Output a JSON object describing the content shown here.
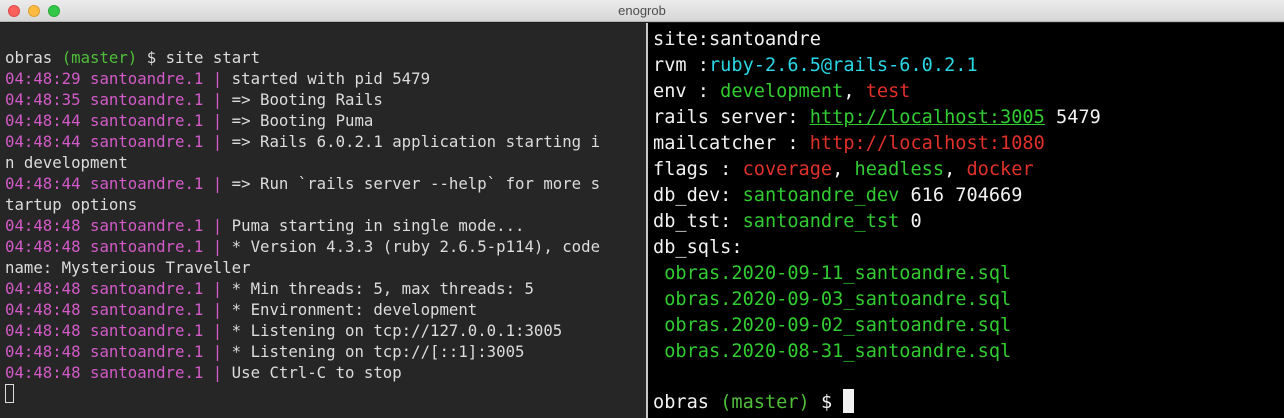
{
  "window": {
    "title": "enogrob"
  },
  "left": {
    "prompt": {
      "dir": "obras",
      "branch": "(master)",
      "symbol": "$",
      "command": "site start"
    },
    "logs": [
      {
        "ts": "04:48:29 santoandre.1 |",
        "msg": " started with pid 5479"
      },
      {
        "ts": "04:48:35 santoandre.1 |",
        "msg": " => Booting Rails"
      },
      {
        "ts": "04:48:44 santoandre.1 |",
        "msg": " => Booting Puma"
      },
      {
        "ts": "04:48:44 santoandre.1 |",
        "msg": " => Rails 6.0.2.1 application starting i"
      },
      {
        "ts": "",
        "msg": "n development"
      },
      {
        "ts": "04:48:44 santoandre.1 |",
        "msg": " => Run `rails server --help` for more s"
      },
      {
        "ts": "",
        "msg": "tartup options"
      },
      {
        "ts": "04:48:48 santoandre.1 |",
        "msg": " Puma starting in single mode..."
      },
      {
        "ts": "04:48:48 santoandre.1 |",
        "msg": " * Version 4.3.3 (ruby 2.6.5-p114), code"
      },
      {
        "ts": "",
        "msg": "name: Mysterious Traveller"
      },
      {
        "ts": "04:48:48 santoandre.1 |",
        "msg": " * Min threads: 5, max threads: 5"
      },
      {
        "ts": "04:48:48 santoandre.1 |",
        "msg": " * Environment: development"
      },
      {
        "ts": "04:48:48 santoandre.1 |",
        "msg": " * Listening on tcp://127.0.0.1:3005"
      },
      {
        "ts": "04:48:48 santoandre.1 |",
        "msg": " * Listening on tcp://[::1]:3005"
      },
      {
        "ts": "04:48:48 santoandre.1 |",
        "msg": " Use Ctrl-C to stop"
      }
    ]
  },
  "right": {
    "site": {
      "label": "site:",
      "value": "santoandre"
    },
    "rvm": {
      "label": "rvm :",
      "value": "ruby-2.6.5@rails-6.0.2.1"
    },
    "env": {
      "label": "env : ",
      "active": "development",
      "sep": ", ",
      "other": "test"
    },
    "rails_server": {
      "label": "rails server: ",
      "url": "http://localhost:3005",
      "pid": " 5479"
    },
    "mailcatcher": {
      "label": "mailcatcher : ",
      "url": "http://localhost:1080"
    },
    "flags": {
      "label": "flags : ",
      "f1": "coverage",
      "s1": ", ",
      "f2": "headless",
      "s2": ", ",
      "f3": "docker"
    },
    "db_dev": {
      "label": "db_dev: ",
      "name": "santoandre_dev",
      "info": " 616 704669"
    },
    "db_tst": {
      "label": "db_tst: ",
      "name": "santoandre_tst",
      "info": " 0"
    },
    "db_sqls": {
      "label": "db_sqls:",
      "files": [
        "obras.2020-09-11_santoandre.sql",
        "obras.2020-09-03_santoandre.sql",
        "obras.2020-09-02_santoandre.sql",
        "obras.2020-08-31_santoandre.sql"
      ]
    },
    "prompt": {
      "dir": "obras",
      "branch": "(master)",
      "symbol": "$"
    }
  },
  "colors": {
    "timestamp": "#d35ac8",
    "branch": "#4fbf3a",
    "green": "#32cc32",
    "cyan": "#2ad7e5",
    "red": "#e0302a"
  }
}
